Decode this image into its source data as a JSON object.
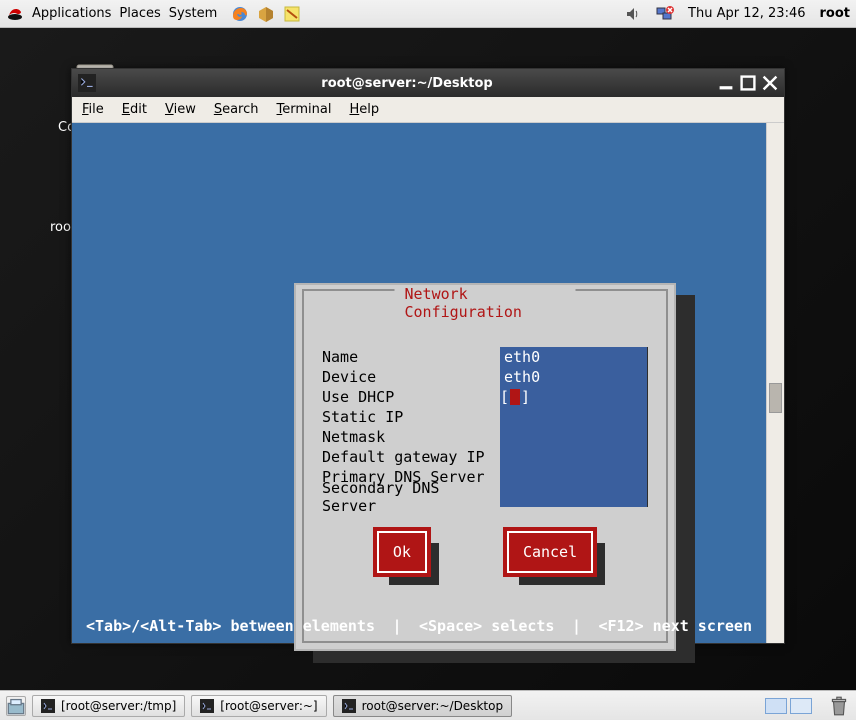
{
  "top_panel": {
    "menus": {
      "applications": "Applications",
      "places": "Places",
      "system": "System"
    },
    "clock": "Thu Apr 12, 23:46",
    "user": "root"
  },
  "desktop": {
    "label_co": "Co",
    "label_root": "roo",
    "caret": "‹"
  },
  "terminal": {
    "title": "root@server:~/Desktop",
    "menus": {
      "file": "File",
      "edit": "Edit",
      "view": "View",
      "search": "Search",
      "terminal": "Terminal",
      "help": "Help"
    },
    "dialog": {
      "title": "Network Configuration",
      "fields": {
        "name_label": "Name",
        "name_value": "eth0",
        "device_label": "Device",
        "device_value": "eth0",
        "dhcp_label": "Use DHCP",
        "staticip_label": "Static IP",
        "staticip_value": "",
        "netmask_label": "Netmask",
        "netmask_value": "",
        "gateway_label": "Default gateway IP",
        "gateway_value": "",
        "dns1_label": "Primary DNS Server",
        "dns1_value": "",
        "dns2_label": "Secondary DNS Server",
        "dns2_value": ""
      },
      "buttons": {
        "ok": "Ok",
        "cancel": "Cancel"
      }
    },
    "hints": {
      "tab": "<Tab>/<Alt-Tab> between elements",
      "sep": "|",
      "space": "<Space> selects",
      "f12": "<F12> next screen"
    }
  },
  "taskbar": {
    "items": [
      {
        "label": "[root@server:/tmp]"
      },
      {
        "label": "[root@server:~]"
      },
      {
        "label": "root@server:~/Desktop"
      }
    ]
  }
}
